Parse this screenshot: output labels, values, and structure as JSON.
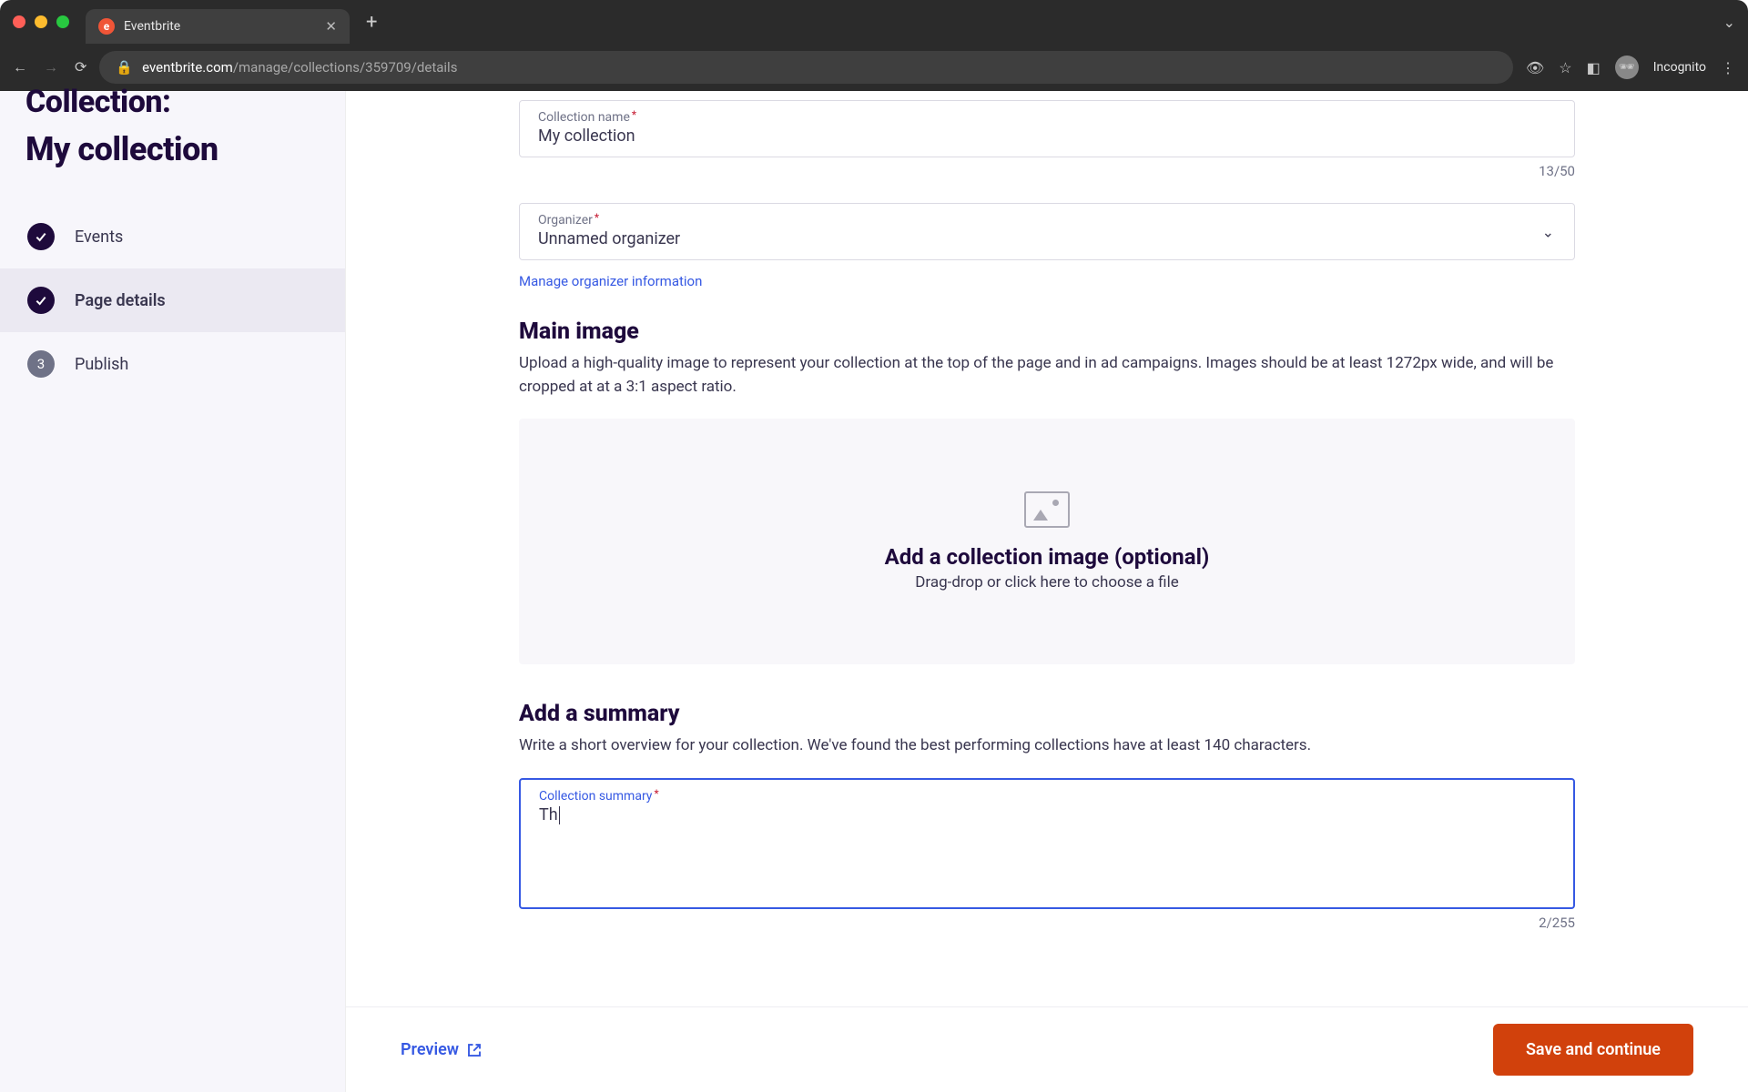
{
  "browser": {
    "tab_title": "Eventbrite",
    "url_host": "eventbrite.com",
    "url_path": "/manage/collections/359709/details",
    "incognito_label": "Incognito",
    "traffic_colors": {
      "close": "#ff5f57",
      "minimize": "#febc2e",
      "maximize": "#28c840"
    }
  },
  "sidebar": {
    "supertitle": "Collection:",
    "title": "My collection",
    "steps": [
      {
        "label": "Events",
        "state": "done"
      },
      {
        "label": "Page details",
        "state": "active"
      },
      {
        "label": "Publish",
        "state": "pending",
        "index": "3"
      }
    ]
  },
  "form": {
    "collection_name_label": "Collection name",
    "collection_name_value": "My collection",
    "collection_name_counter": "13/50",
    "organizer_label": "Organizer",
    "organizer_value": "Unnamed organizer",
    "manage_organizer_link": "Manage organizer information",
    "main_image_heading": "Main image",
    "main_image_text": "Upload a high-quality image to represent your collection at the top of the page and in ad campaigns. Images should be at least 1272px wide, and will be cropped at at a 3:1 aspect ratio.",
    "dropzone_title": "Add a collection image (optional)",
    "dropzone_sub": "Drag-drop or click here to choose a file",
    "summary_heading": "Add a summary",
    "summary_text": "Write a short overview for your collection. We've found the best performing collections have at least 140 characters.",
    "summary_label": "Collection summary",
    "summary_value": "Th",
    "summary_counter": "2/255"
  },
  "footer": {
    "preview_label": "Preview",
    "save_label": "Save and continue"
  }
}
